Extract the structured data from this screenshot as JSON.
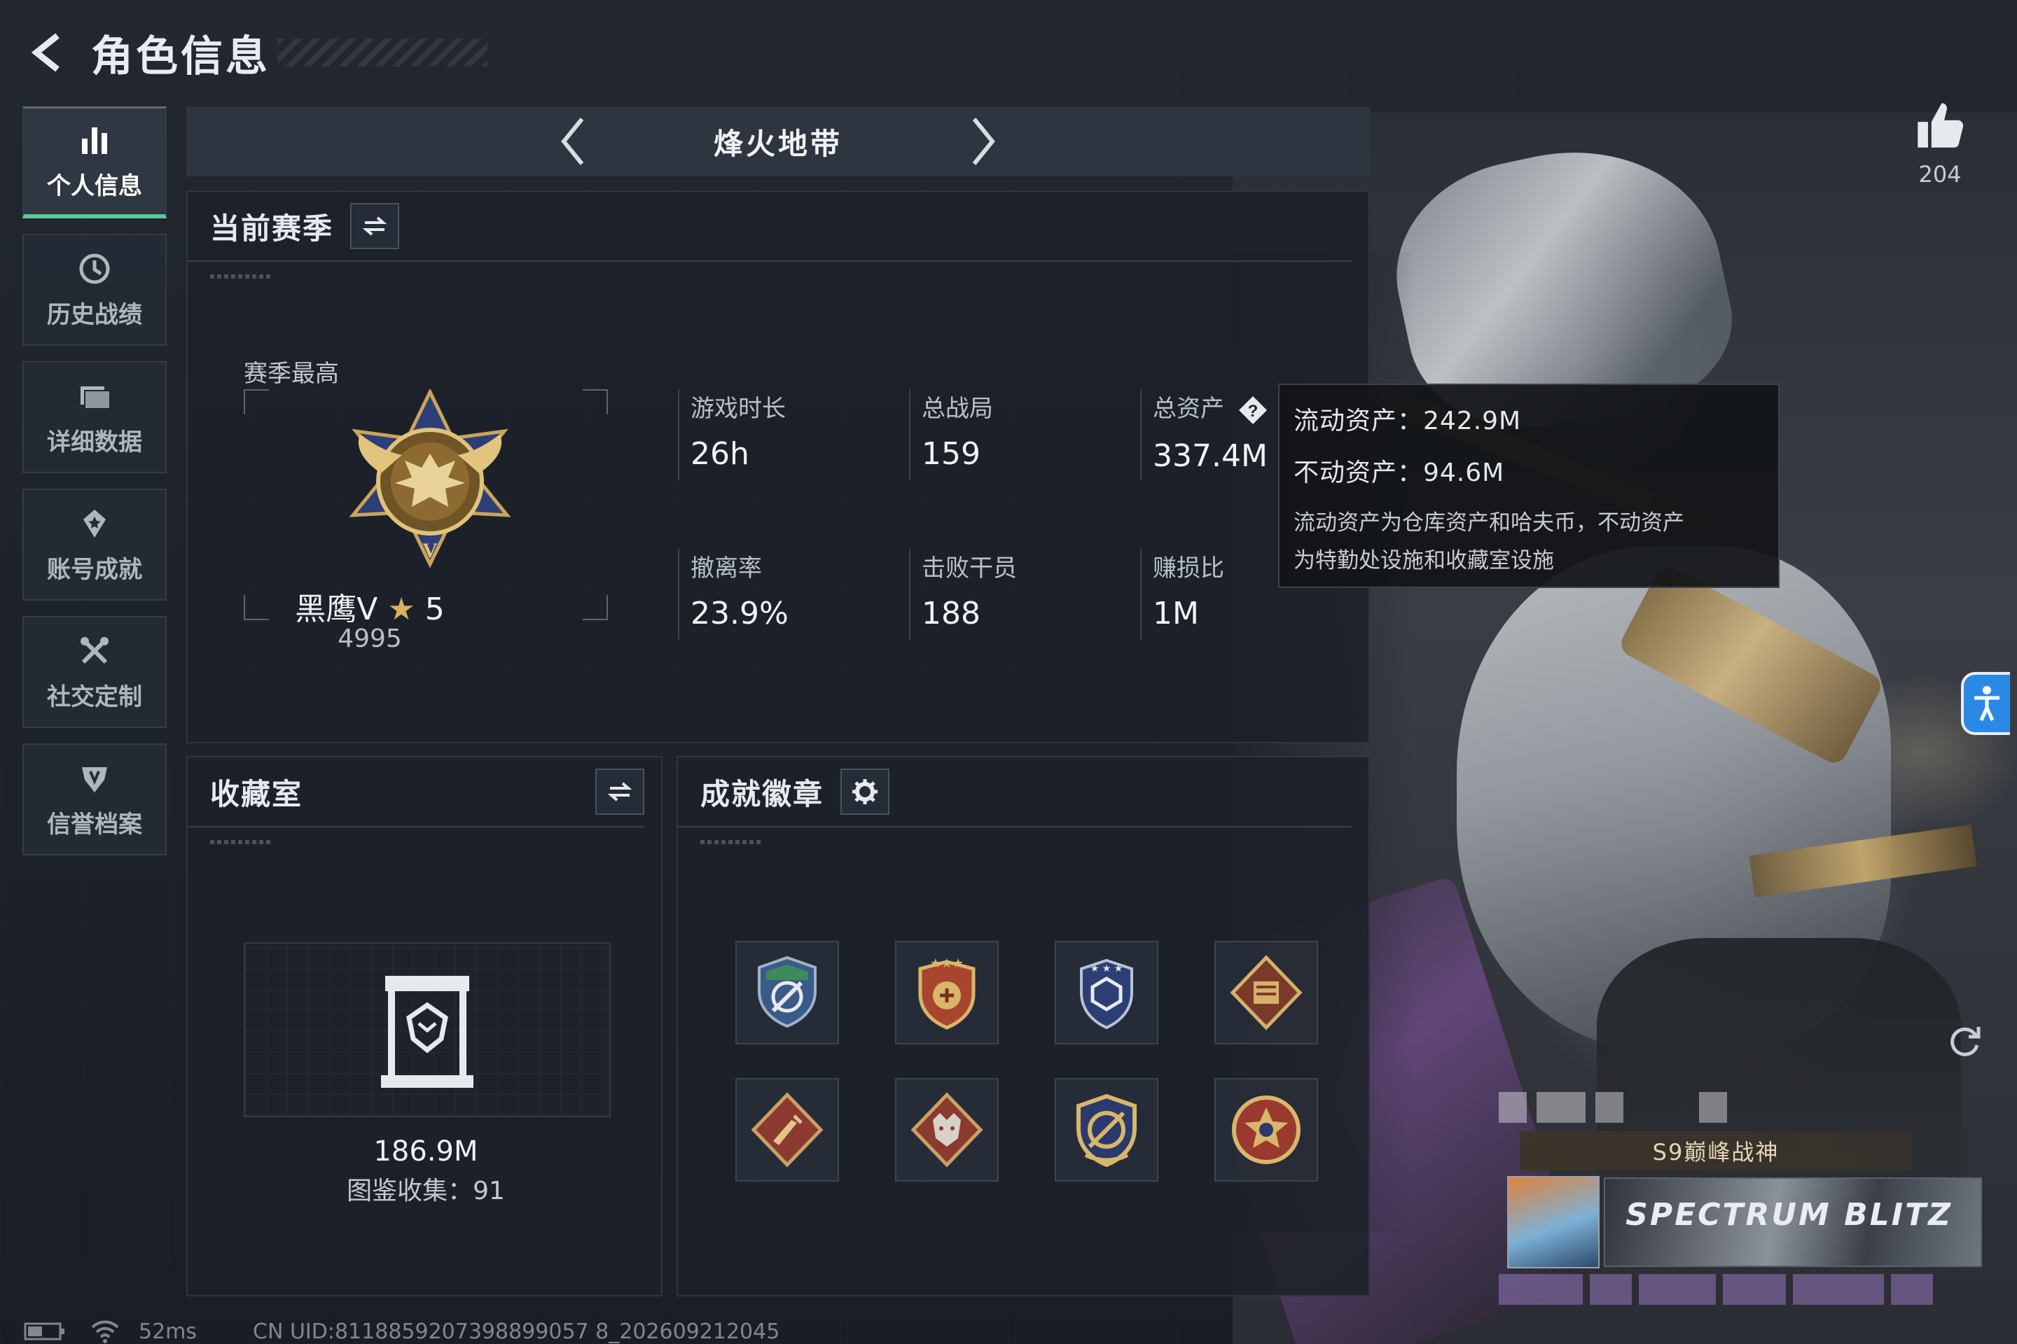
{
  "header": {
    "title": "角色信息"
  },
  "like": {
    "count": "204"
  },
  "sidebar": {
    "items": [
      {
        "label": "个人信息",
        "icon": "bar-chart-icon",
        "active": true
      },
      {
        "label": "历史战绩",
        "icon": "history-icon"
      },
      {
        "label": "详细数据",
        "icon": "folder-icon"
      },
      {
        "label": "账号成就",
        "icon": "achievement-icon"
      },
      {
        "label": "社交定制",
        "icon": "tools-icon"
      },
      {
        "label": "信誉档案",
        "icon": "shield-icon"
      }
    ]
  },
  "mode": {
    "title": "烽火地带"
  },
  "season": {
    "title": "当前赛季",
    "best_label": "赛季最高",
    "rank_name": "黑鹰V",
    "rank_stars": "5",
    "rank_score": "4995",
    "stats": {
      "play_time": {
        "label": "游戏时长",
        "value": "26h"
      },
      "total_matches": {
        "label": "总战局",
        "value": "159"
      },
      "total_assets": {
        "label": "总资产",
        "value": "337.4M"
      },
      "extraction_rate": {
        "label": "撤离率",
        "value": "23.9%"
      },
      "kills": {
        "label": "击败干员",
        "value": "188"
      },
      "profit_ratio": {
        "label": "赚损比",
        "value": "1M"
      }
    }
  },
  "tooltip": {
    "liquid": "流动资产：242.9M",
    "fixed": "不动资产：94.6M",
    "desc_line1": "流动资产为仓库资产和哈夫币，不动资产",
    "desc_line2": "为特勤处设施和收藏室设施"
  },
  "collection": {
    "title": "收藏室",
    "value": "186.9M",
    "count": "图鉴收集：91"
  },
  "badges": {
    "title": "成就徽章",
    "items": [
      "badge-shield-green",
      "badge-gold-stars",
      "badge-blue-shield",
      "badge-red-diamond",
      "badge-red-diamond-2",
      "badge-wolf-diamond",
      "badge-gold-emblem",
      "badge-red-star"
    ]
  },
  "player": {
    "title_tag": "S9巅峰战神",
    "banner_text": "SPECTRUM BLITZ"
  },
  "footer": {
    "ping": "52ms",
    "uid": "CN UID:8118859207398899057 8_202609212045"
  },
  "colors": {
    "accent_green": "#5cc795",
    "gold": "#d9b25c",
    "panel_bg": "#1c2129",
    "accessibility_blue": "#2b89e6"
  }
}
